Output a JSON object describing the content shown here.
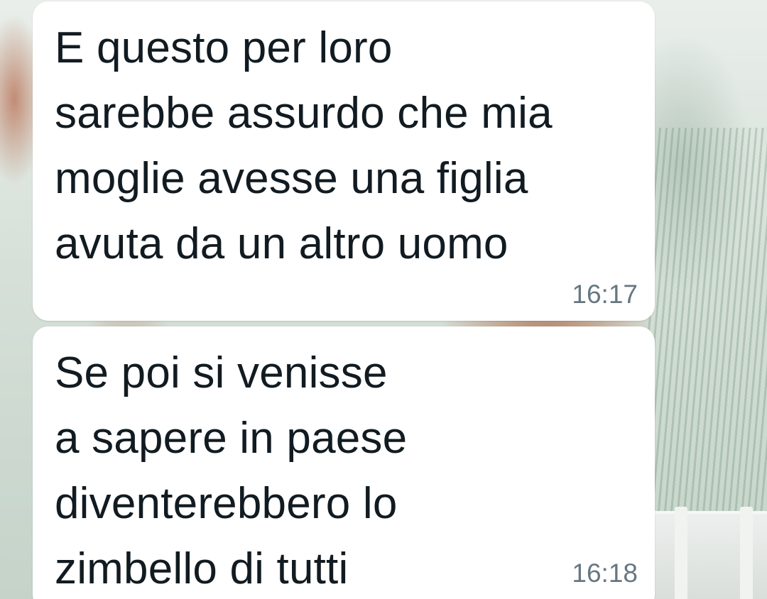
{
  "messages": [
    {
      "lines": [
        "E questo per loro",
        "sarebbe assurdo che mia",
        "moglie avesse una figlia",
        "avuta da un altro uomo"
      ],
      "time": "16:17"
    },
    {
      "lines": [
        "Se poi si venisse",
        "a sapere in paese",
        "diventerebbero lo",
        "zimbello di tutti"
      ],
      "time": "16:18"
    }
  ],
  "colors": {
    "bubble_background": "#ffffff",
    "message_text": "#111b21",
    "timestamp_text": "#667781"
  }
}
